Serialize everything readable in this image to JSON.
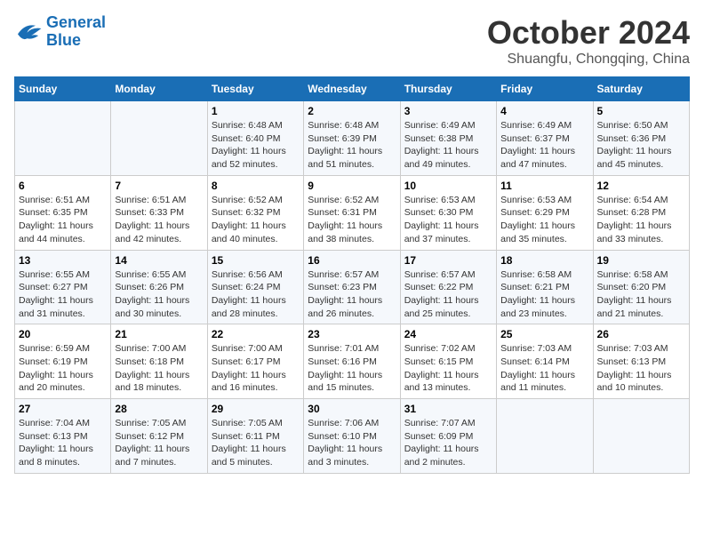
{
  "header": {
    "logo_line1": "General",
    "logo_line2": "Blue",
    "month": "October 2024",
    "location": "Shuangfu, Chongqing, China"
  },
  "weekdays": [
    "Sunday",
    "Monday",
    "Tuesday",
    "Wednesday",
    "Thursday",
    "Friday",
    "Saturday"
  ],
  "weeks": [
    [
      {
        "day": "",
        "info": ""
      },
      {
        "day": "",
        "info": ""
      },
      {
        "day": "1",
        "info": "Sunrise: 6:48 AM\nSunset: 6:40 PM\nDaylight: 11 hours and 52 minutes."
      },
      {
        "day": "2",
        "info": "Sunrise: 6:48 AM\nSunset: 6:39 PM\nDaylight: 11 hours and 51 minutes."
      },
      {
        "day": "3",
        "info": "Sunrise: 6:49 AM\nSunset: 6:38 PM\nDaylight: 11 hours and 49 minutes."
      },
      {
        "day": "4",
        "info": "Sunrise: 6:49 AM\nSunset: 6:37 PM\nDaylight: 11 hours and 47 minutes."
      },
      {
        "day": "5",
        "info": "Sunrise: 6:50 AM\nSunset: 6:36 PM\nDaylight: 11 hours and 45 minutes."
      }
    ],
    [
      {
        "day": "6",
        "info": "Sunrise: 6:51 AM\nSunset: 6:35 PM\nDaylight: 11 hours and 44 minutes."
      },
      {
        "day": "7",
        "info": "Sunrise: 6:51 AM\nSunset: 6:33 PM\nDaylight: 11 hours and 42 minutes."
      },
      {
        "day": "8",
        "info": "Sunrise: 6:52 AM\nSunset: 6:32 PM\nDaylight: 11 hours and 40 minutes."
      },
      {
        "day": "9",
        "info": "Sunrise: 6:52 AM\nSunset: 6:31 PM\nDaylight: 11 hours and 38 minutes."
      },
      {
        "day": "10",
        "info": "Sunrise: 6:53 AM\nSunset: 6:30 PM\nDaylight: 11 hours and 37 minutes."
      },
      {
        "day": "11",
        "info": "Sunrise: 6:53 AM\nSunset: 6:29 PM\nDaylight: 11 hours and 35 minutes."
      },
      {
        "day": "12",
        "info": "Sunrise: 6:54 AM\nSunset: 6:28 PM\nDaylight: 11 hours and 33 minutes."
      }
    ],
    [
      {
        "day": "13",
        "info": "Sunrise: 6:55 AM\nSunset: 6:27 PM\nDaylight: 11 hours and 31 minutes."
      },
      {
        "day": "14",
        "info": "Sunrise: 6:55 AM\nSunset: 6:26 PM\nDaylight: 11 hours and 30 minutes."
      },
      {
        "day": "15",
        "info": "Sunrise: 6:56 AM\nSunset: 6:24 PM\nDaylight: 11 hours and 28 minutes."
      },
      {
        "day": "16",
        "info": "Sunrise: 6:57 AM\nSunset: 6:23 PM\nDaylight: 11 hours and 26 minutes."
      },
      {
        "day": "17",
        "info": "Sunrise: 6:57 AM\nSunset: 6:22 PM\nDaylight: 11 hours and 25 minutes."
      },
      {
        "day": "18",
        "info": "Sunrise: 6:58 AM\nSunset: 6:21 PM\nDaylight: 11 hours and 23 minutes."
      },
      {
        "day": "19",
        "info": "Sunrise: 6:58 AM\nSunset: 6:20 PM\nDaylight: 11 hours and 21 minutes."
      }
    ],
    [
      {
        "day": "20",
        "info": "Sunrise: 6:59 AM\nSunset: 6:19 PM\nDaylight: 11 hours and 20 minutes."
      },
      {
        "day": "21",
        "info": "Sunrise: 7:00 AM\nSunset: 6:18 PM\nDaylight: 11 hours and 18 minutes."
      },
      {
        "day": "22",
        "info": "Sunrise: 7:00 AM\nSunset: 6:17 PM\nDaylight: 11 hours and 16 minutes."
      },
      {
        "day": "23",
        "info": "Sunrise: 7:01 AM\nSunset: 6:16 PM\nDaylight: 11 hours and 15 minutes."
      },
      {
        "day": "24",
        "info": "Sunrise: 7:02 AM\nSunset: 6:15 PM\nDaylight: 11 hours and 13 minutes."
      },
      {
        "day": "25",
        "info": "Sunrise: 7:03 AM\nSunset: 6:14 PM\nDaylight: 11 hours and 11 minutes."
      },
      {
        "day": "26",
        "info": "Sunrise: 7:03 AM\nSunset: 6:13 PM\nDaylight: 11 hours and 10 minutes."
      }
    ],
    [
      {
        "day": "27",
        "info": "Sunrise: 7:04 AM\nSunset: 6:13 PM\nDaylight: 11 hours and 8 minutes."
      },
      {
        "day": "28",
        "info": "Sunrise: 7:05 AM\nSunset: 6:12 PM\nDaylight: 11 hours and 7 minutes."
      },
      {
        "day": "29",
        "info": "Sunrise: 7:05 AM\nSunset: 6:11 PM\nDaylight: 11 hours and 5 minutes."
      },
      {
        "day": "30",
        "info": "Sunrise: 7:06 AM\nSunset: 6:10 PM\nDaylight: 11 hours and 3 minutes."
      },
      {
        "day": "31",
        "info": "Sunrise: 7:07 AM\nSunset: 6:09 PM\nDaylight: 11 hours and 2 minutes."
      },
      {
        "day": "",
        "info": ""
      },
      {
        "day": "",
        "info": ""
      }
    ]
  ]
}
